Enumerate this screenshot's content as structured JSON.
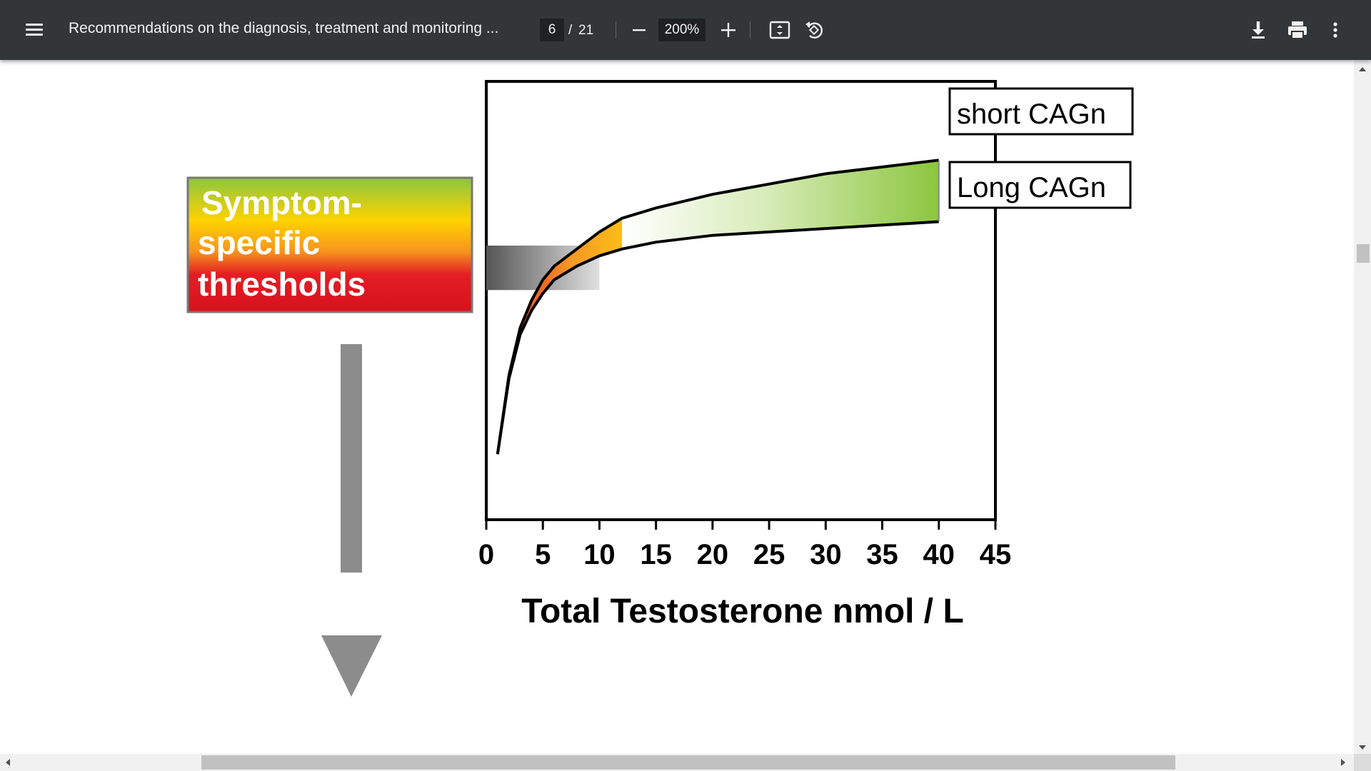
{
  "toolbar": {
    "menu_icon": "hamburger-menu-icon",
    "title": "Recommendations on the diagnosis, treatment and monitoring ...",
    "page_current": "6",
    "page_separator": "/",
    "page_total": "21",
    "zoom_out_icon": "minus-icon",
    "zoom_value": "200%",
    "zoom_in_icon": "plus-icon",
    "fit_icon": "fit-to-page-icon",
    "rotate_icon": "rotate-counterclockwise-icon",
    "download_icon": "download-icon",
    "print_icon": "print-icon",
    "more_icon": "more-vertical-icon",
    "background_color": "#323639"
  },
  "figure": {
    "threshold_box": {
      "lines": [
        "Symptom-",
        "specific",
        "thresholds"
      ],
      "gradient_colors": [
        "#8cc63f",
        "#ffd200",
        "#f7941d",
        "#e31e24"
      ]
    },
    "down_arrow_icon": "down-arrow-icon",
    "legend": {
      "short": "short CAGn",
      "long": "Long CAGn"
    }
  },
  "chart_data": {
    "type": "area",
    "title": "",
    "xlabel": "Total Testosterone nmol / L",
    "ylabel": "",
    "xlim": [
      0,
      45
    ],
    "xticks": [
      "0",
      "5",
      "10",
      "15",
      "20",
      "25",
      "30",
      "35",
      "40",
      "45"
    ],
    "grid": false,
    "series": [
      {
        "name": "short CAGn",
        "x": [
          1,
          2,
          3,
          4,
          5,
          6,
          8,
          10,
          12,
          15,
          20,
          25,
          30,
          35,
          40
        ],
        "y": [
          0.15,
          0.38,
          0.52,
          0.6,
          0.66,
          0.7,
          0.75,
          0.8,
          0.84,
          0.87,
          0.91,
          0.94,
          0.97,
          0.99,
          1.01
        ],
        "color": "#8cc63f"
      },
      {
        "name": "Long CAGn",
        "x": [
          1,
          2,
          3,
          4,
          5,
          6,
          8,
          10,
          12,
          15,
          20,
          25,
          30,
          35,
          40
        ],
        "y": [
          0.15,
          0.37,
          0.5,
          0.57,
          0.62,
          0.66,
          0.7,
          0.73,
          0.75,
          0.77,
          0.79,
          0.8,
          0.81,
          0.82,
          0.83
        ],
        "color": "#000000"
      }
    ],
    "threshold_band": {
      "y": [
        0.63,
        0.76
      ]
    }
  },
  "colors": {
    "scrollbar_track": "#f1f1f1",
    "scrollbar_thumb": "#c1c1c1",
    "arrow_gray": "#8c8c8c"
  }
}
